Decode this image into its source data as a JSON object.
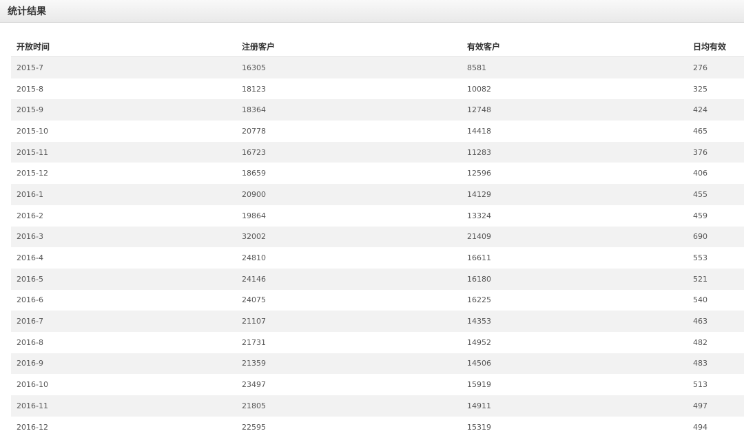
{
  "panel": {
    "title": "统计结果"
  },
  "table": {
    "headers": [
      "开放时间",
      "注册客户",
      "有效客户",
      "日均有效"
    ],
    "rows": [
      [
        "2015-7",
        "16305",
        "8581",
        "276"
      ],
      [
        "2015-8",
        "18123",
        "10082",
        "325"
      ],
      [
        "2015-9",
        "18364",
        "12748",
        "424"
      ],
      [
        "2015-10",
        "20778",
        "14418",
        "465"
      ],
      [
        "2015-11",
        "16723",
        "11283",
        "376"
      ],
      [
        "2015-12",
        "18659",
        "12596",
        "406"
      ],
      [
        "2016-1",
        "20900",
        "14129",
        "455"
      ],
      [
        "2016-2",
        "19864",
        "13324",
        "459"
      ],
      [
        "2016-3",
        "32002",
        "21409",
        "690"
      ],
      [
        "2016-4",
        "24810",
        "16611",
        "553"
      ],
      [
        "2016-5",
        "24146",
        "16180",
        "521"
      ],
      [
        "2016-6",
        "24075",
        "16225",
        "540"
      ],
      [
        "2016-7",
        "21107",
        "14353",
        "463"
      ],
      [
        "2016-8",
        "21731",
        "14952",
        "482"
      ],
      [
        "2016-9",
        "21359",
        "14506",
        "483"
      ],
      [
        "2016-10",
        "23497",
        "15919",
        "513"
      ],
      [
        "2016-11",
        "21805",
        "14911",
        "497"
      ],
      [
        "2016-12",
        "22595",
        "15319",
        "494"
      ]
    ]
  }
}
